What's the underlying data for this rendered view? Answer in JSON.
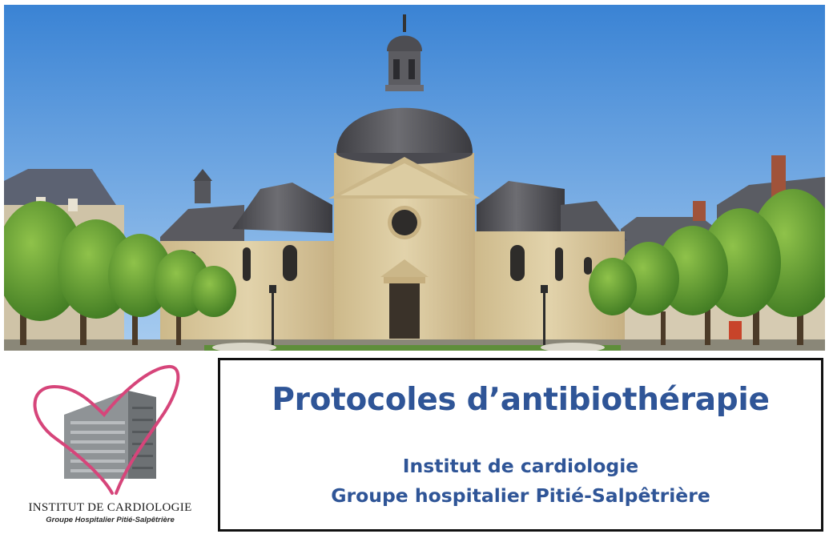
{
  "hero": {
    "sky_top": "#3a83d4",
    "sky_bottom": "#a9cdf0",
    "stone": "#d9c9a0",
    "roof": "#5a5a5e"
  },
  "logo": {
    "heart_color": "#d6457a",
    "line1": "INSTITUT DE CARDIOLOGIE",
    "line2": "Groupe Hospitalier Pitié-Salpêtrière"
  },
  "title_box": {
    "title": "Protocoles d’antibiothérapie",
    "subtitle_line1": "Institut de cardiologie",
    "subtitle_line2": "Groupe hospitalier Pitié-Salpêtrière",
    "text_color": "#2f5597"
  }
}
